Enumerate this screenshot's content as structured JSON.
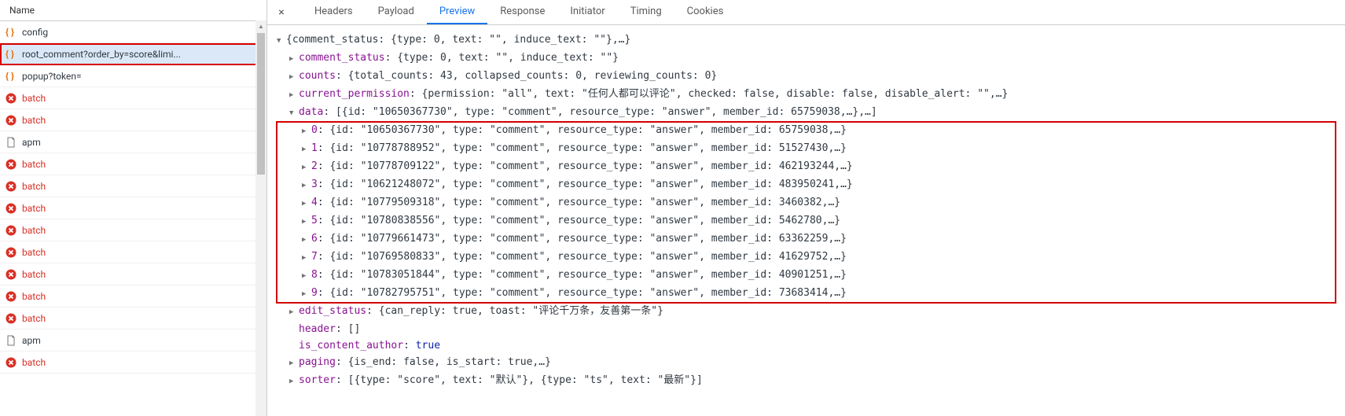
{
  "sidebar": {
    "header": "Name",
    "requests": [
      {
        "icon": "json",
        "name": "config"
      },
      {
        "icon": "json",
        "name": "root_comment?order_by=score&limi...",
        "selected": true
      },
      {
        "icon": "json",
        "name": "popup?token="
      },
      {
        "icon": "error",
        "name": "batch"
      },
      {
        "icon": "error",
        "name": "batch"
      },
      {
        "icon": "doc",
        "name": "apm"
      },
      {
        "icon": "error",
        "name": "batch"
      },
      {
        "icon": "error",
        "name": "batch"
      },
      {
        "icon": "error",
        "name": "batch"
      },
      {
        "icon": "error",
        "name": "batch"
      },
      {
        "icon": "error",
        "name": "batch"
      },
      {
        "icon": "error",
        "name": "batch"
      },
      {
        "icon": "error",
        "name": "batch"
      },
      {
        "icon": "error",
        "name": "batch"
      },
      {
        "icon": "doc",
        "name": "apm"
      },
      {
        "icon": "error",
        "name": "batch"
      }
    ]
  },
  "tabs": {
    "close": "×",
    "items": [
      "Headers",
      "Payload",
      "Preview",
      "Response",
      "Initiator",
      "Timing",
      "Cookies"
    ],
    "active": 2
  },
  "response": {
    "root_summary": "{comment_status: {type: 0, text: \"\", induce_text: \"\"},…}",
    "comment_status": "{type: 0, text: \"\", induce_text: \"\"}",
    "counts": "{total_counts: 43, collapsed_counts: 0, reviewing_counts: 0}",
    "current_permission": "{permission: \"all\", text: \"任何人都可以评论\", checked: false, disable: false, disable_alert: \"\",…}",
    "data_summary": "[{id: \"10650367730\", type: \"comment\", resource_type: \"answer\", member_id: 65759038,…},…]",
    "data": [
      {
        "idx": "0",
        "val": "{id: \"10650367730\", type: \"comment\", resource_type: \"answer\", member_id: 65759038,…}"
      },
      {
        "idx": "1",
        "val": "{id: \"10778788952\", type: \"comment\", resource_type: \"answer\", member_id: 51527430,…}"
      },
      {
        "idx": "2",
        "val": "{id: \"10778709122\", type: \"comment\", resource_type: \"answer\", member_id: 462193244,…}"
      },
      {
        "idx": "3",
        "val": "{id: \"10621248072\", type: \"comment\", resource_type: \"answer\", member_id: 483950241,…}"
      },
      {
        "idx": "4",
        "val": "{id: \"10779509318\", type: \"comment\", resource_type: \"answer\", member_id: 3460382,…}"
      },
      {
        "idx": "5",
        "val": "{id: \"10780838556\", type: \"comment\", resource_type: \"answer\", member_id: 5462780,…}"
      },
      {
        "idx": "6",
        "val": "{id: \"10779661473\", type: \"comment\", resource_type: \"answer\", member_id: 63362259,…}"
      },
      {
        "idx": "7",
        "val": "{id: \"10769580833\", type: \"comment\", resource_type: \"answer\", member_id: 41629752,…}"
      },
      {
        "idx": "8",
        "val": "{id: \"10783051844\", type: \"comment\", resource_type: \"answer\", member_id: 40901251,…}"
      },
      {
        "idx": "9",
        "val": "{id: \"10782795751\", type: \"comment\", resource_type: \"answer\", member_id: 73683414,…}"
      }
    ],
    "edit_status": "{can_reply: true, toast: \"评论千万条，友善第一条\"}",
    "header": "[]",
    "is_content_author": "true",
    "paging": "{is_end: false, is_start: true,…}",
    "sorter": "[{type: \"score\", text: \"默认\"}, {type: \"ts\", text: \"最新\"}]",
    "labels": {
      "comment_status": "comment_status",
      "counts": "counts",
      "current_permission": "current_permission",
      "data": "data",
      "edit_status": "edit_status",
      "header": "header",
      "is_content_author": "is_content_author",
      "paging": "paging",
      "sorter": "sorter"
    }
  }
}
